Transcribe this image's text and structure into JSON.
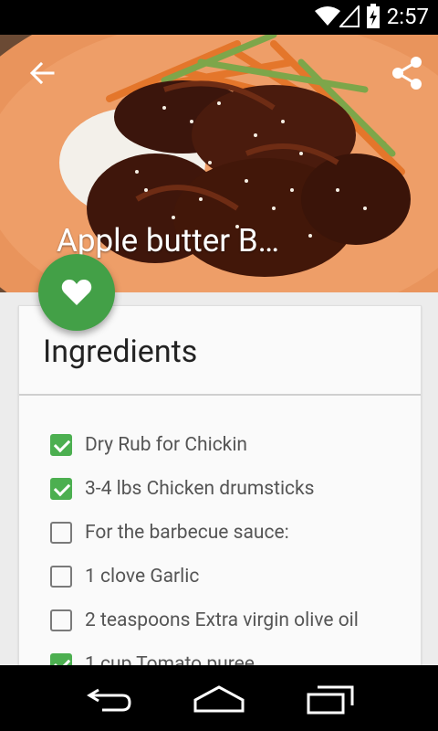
{
  "status_bar": {
    "time": "2:57"
  },
  "hero": {
    "title": "Apple butter B…"
  },
  "ingredients": {
    "heading": "Ingredients",
    "items": [
      {
        "label": "Dry Rub for Chickin",
        "checked": true
      },
      {
        "label": "3-4 lbs Chicken drumsticks",
        "checked": true
      },
      {
        "label": "For the barbecue sauce:",
        "checked": false
      },
      {
        "label": "1 clove Garlic",
        "checked": false
      },
      {
        "label": "2 teaspoons Extra virgin olive oil",
        "checked": false
      },
      {
        "label": "1 cup Tomato puree",
        "checked": true
      }
    ]
  },
  "colors": {
    "accent": "#43a047",
    "checkbox": "#4caf50",
    "plate": "#e9945c"
  },
  "icons": [
    "wifi-icon",
    "signal-icon",
    "battery-icon",
    "back-arrow-icon",
    "share-icon",
    "heart-icon",
    "nav-back-icon",
    "nav-home-icon",
    "nav-recents-icon"
  ]
}
